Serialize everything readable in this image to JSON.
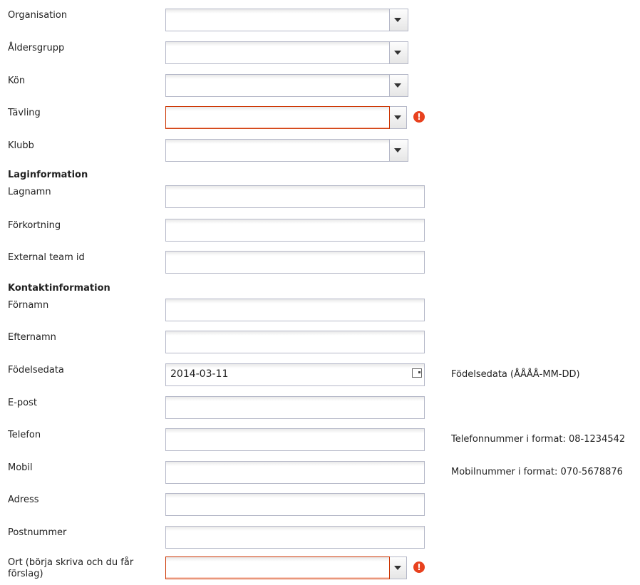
{
  "fields": {
    "organisation": {
      "label": "Organisation",
      "value": ""
    },
    "aldersgrupp": {
      "label": "Åldersgrupp",
      "value": ""
    },
    "kon": {
      "label": "Kön",
      "value": ""
    },
    "tavling": {
      "label": "Tävling",
      "value": ""
    },
    "klubb": {
      "label": "Klubb",
      "value": ""
    }
  },
  "laginformation": {
    "heading": "Laginformation",
    "lagnamn": {
      "label": "Lagnamn",
      "value": ""
    },
    "forkortning": {
      "label": "Förkortning",
      "value": ""
    },
    "external_team_id": {
      "label": "External team id",
      "value": ""
    }
  },
  "kontaktinformation": {
    "heading": "Kontaktinformation",
    "fornamn": {
      "label": "Förnamn",
      "value": ""
    },
    "efternamn": {
      "label": "Efternamn",
      "value": ""
    },
    "fodelsedata": {
      "label": "Födelsedata",
      "value": "2014-03-11",
      "hint": "Födelsedata (ÅÅÅÅ-MM-DD)"
    },
    "epost": {
      "label": "E-post",
      "value": ""
    },
    "telefon": {
      "label": "Telefon",
      "value": "",
      "hint": "Telefonnummer i format: 08-1234542"
    },
    "mobil": {
      "label": "Mobil",
      "value": "",
      "hint": "Mobilnummer i format: 070-5678876"
    },
    "adress": {
      "label": "Adress",
      "value": ""
    },
    "postnummer": {
      "label": "Postnummer",
      "value": ""
    },
    "ort": {
      "label_line1": "Ort (börja skriva och du får",
      "label_line2": "förslag)",
      "value": ""
    }
  },
  "icons": {
    "dropdown": "chevron-down-icon",
    "error": "error-icon",
    "calendar": "calendar-icon"
  },
  "colors": {
    "invalid_border": "#cc3300",
    "error_icon": "#e8411e",
    "field_border": "#b5b8c8"
  }
}
